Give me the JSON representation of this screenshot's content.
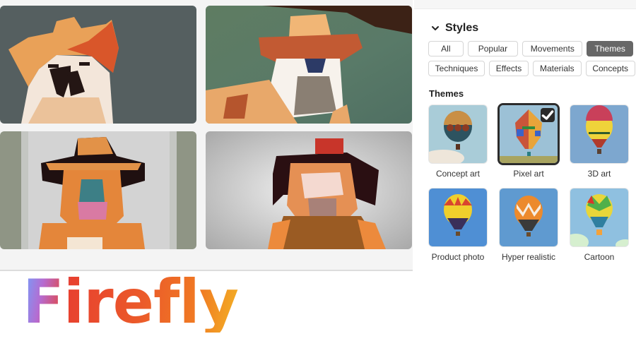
{
  "gallery": {
    "images": [
      {
        "alt": "Pixel art bulldog wearing orange cowboy hat on slate background"
      },
      {
        "alt": "Pixel art bulldog wearing cowboy hat on green background"
      },
      {
        "alt": "Pixel art bulldog wearing wide-brim hat on gray background"
      },
      {
        "alt": "Pixel art bulldog wearing small red hat on gray gradient background"
      }
    ]
  },
  "styles_panel": {
    "title": "Styles",
    "chips_row1": [
      {
        "label": "All",
        "active": false
      },
      {
        "label": "Popular",
        "active": false
      },
      {
        "label": "Movements",
        "active": false
      },
      {
        "label": "Themes",
        "active": true
      }
    ],
    "chips_row2": [
      {
        "label": "Techniques",
        "active": false
      },
      {
        "label": "Effects",
        "active": false
      },
      {
        "label": "Materials",
        "active": false
      },
      {
        "label": "Concepts",
        "active": false
      }
    ],
    "section_title": "Themes",
    "themes": [
      {
        "label": "Concept art",
        "selected": false
      },
      {
        "label": "Pixel art",
        "selected": true
      },
      {
        "label": "3D art",
        "selected": false
      },
      {
        "label": "Product photo",
        "selected": false
      },
      {
        "label": "Hyper realistic",
        "selected": false
      },
      {
        "label": "Cartoon",
        "selected": false
      }
    ]
  },
  "logo": {
    "text": "Firefly"
  }
}
